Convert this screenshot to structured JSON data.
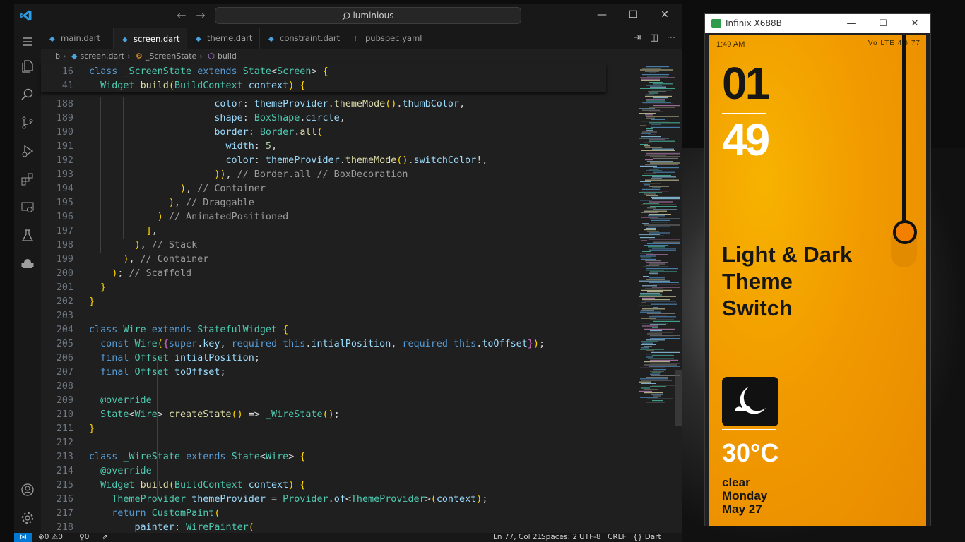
{
  "vscode": {
    "search_text": "luminious",
    "tabs": [
      {
        "label": "main.dart",
        "active": false
      },
      {
        "label": "screen.dart",
        "active": true
      },
      {
        "label": "theme.dart",
        "active": false
      },
      {
        "label": "constraint.dart",
        "active": false
      },
      {
        "label": "pubspec.yaml",
        "active": false
      }
    ],
    "breadcrumb": [
      "lib",
      "screen.dart",
      "_ScreenState",
      "build"
    ],
    "sticky": [
      {
        "num": "16",
        "text": "class _ScreenState extends State<Screen> {"
      },
      {
        "num": "41",
        "text": "  Widget build(BuildContext context) {"
      }
    ],
    "lines": [
      {
        "num": "188",
        "text": "                      color: themeProvider.themeMode().thumbColor,"
      },
      {
        "num": "189",
        "text": "                      shape: BoxShape.circle,"
      },
      {
        "num": "190",
        "text": "                      border: Border.all("
      },
      {
        "num": "191",
        "text": "                        width: 5,"
      },
      {
        "num": "192",
        "text": "                        color: themeProvider.themeMode().switchColor!,"
      },
      {
        "num": "193",
        "text": "                      )), // Border.all // BoxDecoration"
      },
      {
        "num": "194",
        "text": "                ), // Container"
      },
      {
        "num": "195",
        "text": "              ), // Draggable"
      },
      {
        "num": "196",
        "text": "            ) // AnimatedPositioned"
      },
      {
        "num": "197",
        "text": "          ],"
      },
      {
        "num": "198",
        "text": "        ), // Stack"
      },
      {
        "num": "199",
        "text": "      ), // Container"
      },
      {
        "num": "200",
        "text": "    ); // Scaffold"
      },
      {
        "num": "201",
        "text": "  }"
      },
      {
        "num": "202",
        "text": "}"
      },
      {
        "num": "203",
        "text": ""
      },
      {
        "num": "204",
        "text": "class Wire extends StatefulWidget {"
      },
      {
        "num": "205",
        "text": "  const Wire({super.key, required this.intialPosition, required this.toOffset});"
      },
      {
        "num": "206",
        "text": "  final Offset intialPosition;"
      },
      {
        "num": "207",
        "text": "  final Offset toOffset;"
      },
      {
        "num": "208",
        "text": ""
      },
      {
        "num": "209",
        "text": "  @override"
      },
      {
        "num": "210",
        "text": "  State<Wire> createState() => _WireState();"
      },
      {
        "num": "211",
        "text": "}"
      },
      {
        "num": "212",
        "text": ""
      },
      {
        "num": "213",
        "text": "class _WireState extends State<Wire> {"
      },
      {
        "num": "214",
        "text": "  @override"
      },
      {
        "num": "215",
        "text": "  Widget build(BuildContext context) {"
      },
      {
        "num": "216",
        "text": "    ThemeProvider themeProvider = Provider.of<ThemeProvider>(context);"
      },
      {
        "num": "217",
        "text": "    return CustomPaint("
      },
      {
        "num": "218",
        "text": "        painter: WirePainter("
      }
    ],
    "status": {
      "errors": "⊗0 ⚠0",
      "ports": "⚲0",
      "cursor": "Ln 77, Col 21",
      "spaces": "Spaces: 2",
      "encoding": "UTF-8",
      "eol": "CRLF",
      "language": "{} Dart"
    }
  },
  "emulator": {
    "title": "Infinix X688B",
    "status_time": "1:49 AM",
    "status_right": "Vo LTE 4G 77",
    "hour": "01",
    "minute": "49",
    "heading_lines": [
      "Light & Dark",
      "Theme",
      "Switch"
    ],
    "temperature": "30°C",
    "condition": "clear",
    "day": "Monday",
    "date": "May 27",
    "colors": {
      "accent": "#f19a00",
      "knob": "#f27f00"
    }
  }
}
